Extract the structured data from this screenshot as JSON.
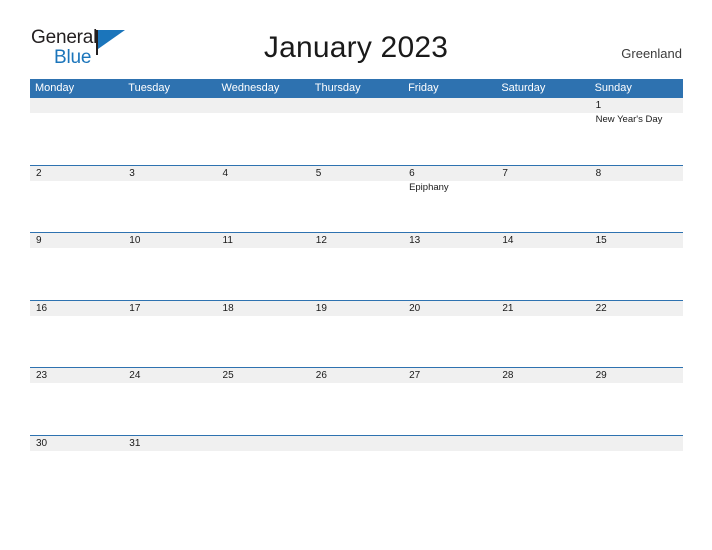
{
  "logo": {
    "word_top": "General",
    "word_bottom": "Blue",
    "flag_color": "#1b75bb"
  },
  "header": {
    "title": "January 2023",
    "country": "Greenland"
  },
  "theme": {
    "header_blue": "#2e72b0",
    "date_band": "#f0f0f0",
    "rule": "#2e72b0"
  },
  "calendar": {
    "weekdays": [
      "Monday",
      "Tuesday",
      "Wednesday",
      "Thursday",
      "Friday",
      "Saturday",
      "Sunday"
    ],
    "weeks": [
      {
        "days": [
          {
            "num": "",
            "event": ""
          },
          {
            "num": "",
            "event": ""
          },
          {
            "num": "",
            "event": ""
          },
          {
            "num": "",
            "event": ""
          },
          {
            "num": "",
            "event": ""
          },
          {
            "num": "",
            "event": ""
          },
          {
            "num": "1",
            "event": "New Year's Day"
          }
        ]
      },
      {
        "days": [
          {
            "num": "2",
            "event": ""
          },
          {
            "num": "3",
            "event": ""
          },
          {
            "num": "4",
            "event": ""
          },
          {
            "num": "5",
            "event": ""
          },
          {
            "num": "6",
            "event": "Epiphany"
          },
          {
            "num": "7",
            "event": ""
          },
          {
            "num": "8",
            "event": ""
          }
        ]
      },
      {
        "days": [
          {
            "num": "9",
            "event": ""
          },
          {
            "num": "10",
            "event": ""
          },
          {
            "num": "11",
            "event": ""
          },
          {
            "num": "12",
            "event": ""
          },
          {
            "num": "13",
            "event": ""
          },
          {
            "num": "14",
            "event": ""
          },
          {
            "num": "15",
            "event": ""
          }
        ]
      },
      {
        "days": [
          {
            "num": "16",
            "event": ""
          },
          {
            "num": "17",
            "event": ""
          },
          {
            "num": "18",
            "event": ""
          },
          {
            "num": "19",
            "event": ""
          },
          {
            "num": "20",
            "event": ""
          },
          {
            "num": "21",
            "event": ""
          },
          {
            "num": "22",
            "event": ""
          }
        ]
      },
      {
        "days": [
          {
            "num": "23",
            "event": ""
          },
          {
            "num": "24",
            "event": ""
          },
          {
            "num": "25",
            "event": ""
          },
          {
            "num": "26",
            "event": ""
          },
          {
            "num": "27",
            "event": ""
          },
          {
            "num": "28",
            "event": ""
          },
          {
            "num": "29",
            "event": ""
          }
        ]
      },
      {
        "days": [
          {
            "num": "30",
            "event": ""
          },
          {
            "num": "31",
            "event": ""
          },
          {
            "num": "",
            "event": ""
          },
          {
            "num": "",
            "event": ""
          },
          {
            "num": "",
            "event": ""
          },
          {
            "num": "",
            "event": ""
          },
          {
            "num": "",
            "event": ""
          }
        ]
      }
    ]
  }
}
